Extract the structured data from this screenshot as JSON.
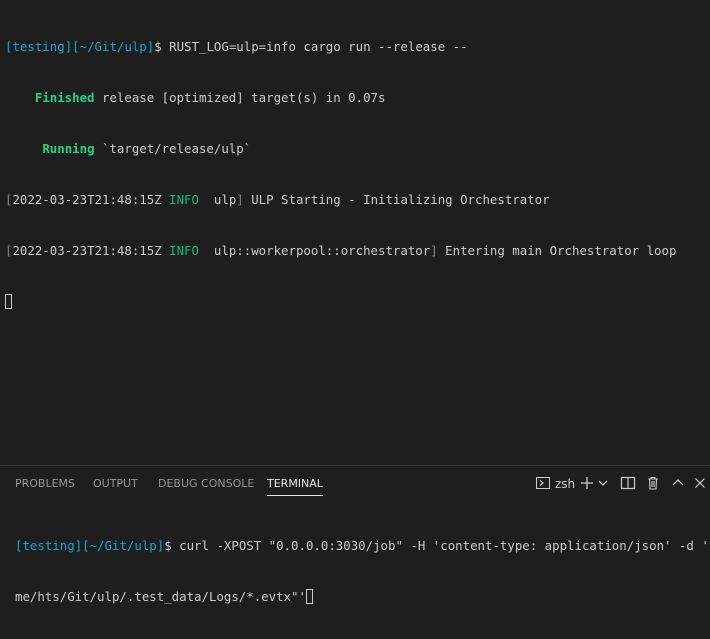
{
  "top_terminal": {
    "line1": {
      "prompt_open": "[",
      "prompt_env": "testing",
      "prompt_mid": "][",
      "prompt_path": "~/Git/ulp",
      "prompt_close": "]",
      "dollar": "$ ",
      "command": "RUST_LOG=ulp=info cargo run --release --"
    },
    "line2": {
      "indent": "    ",
      "status": "Finished",
      "text": " release [optimized] target(s) in 0.07s"
    },
    "line3": {
      "indent": "     ",
      "status": "Running",
      "text": " `target/release/ulp`"
    },
    "log1": {
      "open": "[",
      "timestamp": "2022-03-23T21:48:15Z",
      "level": " INFO ",
      "module": " ulp",
      "close": "]",
      "message": " ULP Starting - Initializing Orchestrator"
    },
    "log2": {
      "open": "[",
      "timestamp": "2022-03-23T21:48:15Z",
      "level": " INFO ",
      "module": " ulp::workerpool::orchestrator",
      "close": "]",
      "message": " Entering main Orchestrator loop"
    }
  },
  "panel": {
    "tabs": [
      "PROBLEMS",
      "OUTPUT",
      "DEBUG CONSOLE",
      "TERMINAL"
    ],
    "active_tab": "TERMINAL",
    "shell_name": "zsh",
    "icons": {
      "shell": "terminal-icon",
      "add": "plus-icon",
      "dropdown": "chevron-down-icon",
      "split": "split-terminal-icon",
      "trash": "trash-icon",
      "maximize": "chevron-up-icon",
      "close": "close-icon"
    }
  },
  "bottom_terminal": {
    "prompt_open": "[",
    "prompt_env": "testing",
    "prompt_mid": "][",
    "prompt_path": "~/Git/ulp",
    "prompt_close": "]",
    "dollar": "$ ",
    "command_line1": "curl -XPOST \"0.0.0.0:3030/job\" -H 'content-type: application/json' -d '\"/ho",
    "command_line2": "me/hts/Git/ulp/.test_data/Logs/*.evtx\"'"
  },
  "colors": {
    "background": "#1e1e1e",
    "foreground": "#cccccc",
    "prompt_cyan": "#11a8cd",
    "success_green": "#23d18b",
    "info_green": "#0dbc79"
  }
}
